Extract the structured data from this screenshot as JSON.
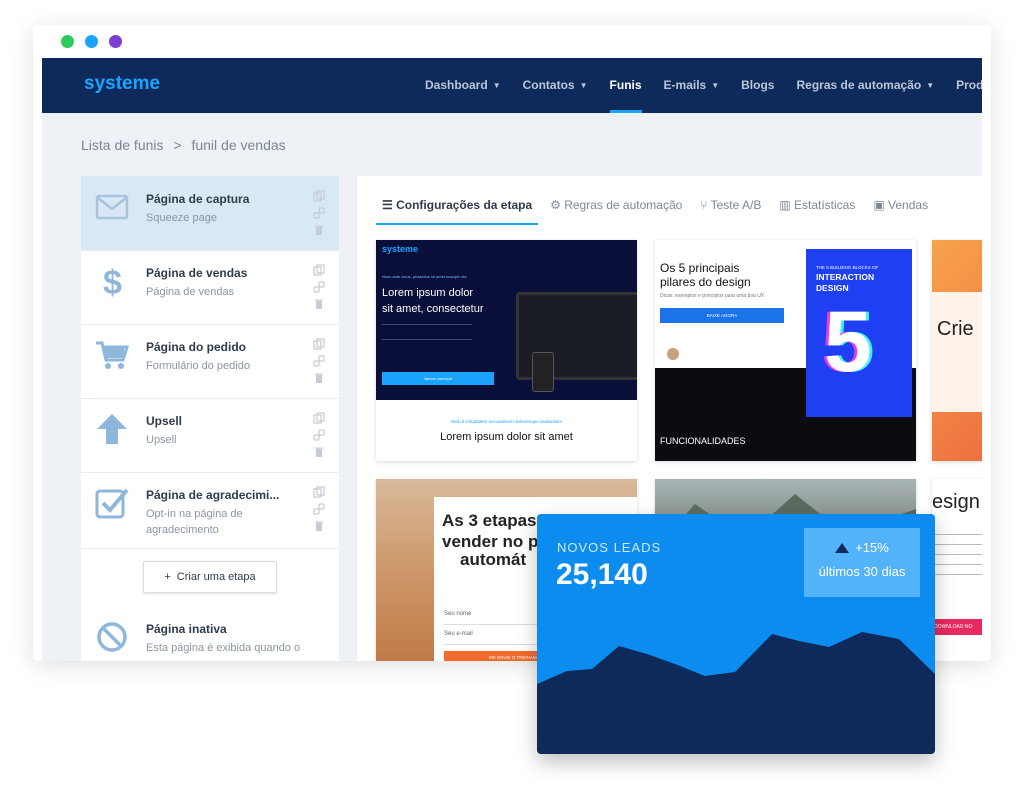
{
  "window": {
    "dot_colors": [
      "#2dcb5d",
      "#1aa3ff",
      "#7b3fd1"
    ]
  },
  "nav": {
    "logo": "systeme",
    "items": [
      {
        "label": "Dashboard",
        "caret": true,
        "active": false
      },
      {
        "label": "Contatos",
        "caret": true,
        "active": false
      },
      {
        "label": "Funis",
        "caret": false,
        "active": true
      },
      {
        "label": "E-mails",
        "caret": true,
        "active": false
      },
      {
        "label": "Blogs",
        "caret": false,
        "active": false
      },
      {
        "label": "Regras de automação",
        "caret": true,
        "active": false
      },
      {
        "label": "Produto",
        "caret": false,
        "active": false
      }
    ]
  },
  "breadcrumb": {
    "root": "Lista de funis",
    "separator": ">",
    "current": "funil de vendas"
  },
  "steps": [
    {
      "title": "Página de captura",
      "subtitle": "Squeeze page",
      "icon": "envelope-icon",
      "active": true
    },
    {
      "title": "Página de vendas",
      "subtitle": "Página de vendas",
      "icon": "dollar-icon",
      "active": false
    },
    {
      "title": "Página do pedido",
      "subtitle": "Formulário do pedido",
      "icon": "cart-icon",
      "active": false
    },
    {
      "title": "Upsell",
      "subtitle": "Upsell",
      "icon": "arrow-up-icon",
      "active": false
    },
    {
      "title": "Página de agradecimi...",
      "subtitle": "Opt-in na página de agradecimento",
      "icon": "checkbox-icon",
      "active": false
    },
    {
      "title": "Página inativa",
      "subtitle": "Esta página é exibida quando o",
      "icon": "disabled-icon",
      "active": false
    }
  ],
  "create_step": {
    "plus": "+",
    "label": "Criar uma etapa"
  },
  "tabs": [
    {
      "label": "Configurações da etapa",
      "icon": "menu-icon",
      "active": true
    },
    {
      "label": "Regras de automação",
      "icon": "gears-icon",
      "active": false
    },
    {
      "label": "Teste A/B",
      "icon": "split-icon",
      "active": false
    },
    {
      "label": "Estatísticas",
      "icon": "bar-chart-icon",
      "active": false
    },
    {
      "label": "Vendas",
      "icon": "money-icon",
      "active": false
    }
  ],
  "thumbnails": {
    "t1": {
      "brand": "systeme",
      "kicker": "Nunc ante lacus, phasellus sit amet suscipit nec",
      "headline1": "Lorem ipsum dolor",
      "headline2": "sit amet, consectetur",
      "button": "Vamos começar",
      "caption": "Sed ut voluptatem accusantium doloremque laudantium",
      "headline3": "Lorem ipsum dolor sit amet"
    },
    "t2": {
      "headline1": "Os 5 principais",
      "headline2": "pilares do design",
      "sub": "Dicas, exemplos e princípios para uma boa UX",
      "button": "BAIXE AGORA",
      "book_kicker": "THE 5 BUILDING BLOCKS OF",
      "book_title1": "INTERACTION",
      "book_title2": "DESIGN",
      "book_number": "5",
      "footer": "FUNCIONALIDADES"
    },
    "t3": {
      "headline": "Crie"
    },
    "t4": {
      "headline1": "As 3 etapas",
      "headline2": "vender no p",
      "headline3": "automát",
      "name_placeholder": "Seu nome",
      "email_placeholder": "Seu e-mail",
      "button": "ME ENVIE O TREINAMENTO"
    },
    "t6": {
      "headline": "esign",
      "button": "DOWNLOAD NO"
    }
  },
  "leads_card": {
    "label": "NOVOS LEADS",
    "value": "25,140",
    "delta": "+15%",
    "period": "últimos 30 dias"
  },
  "colors": {
    "nav_bg": "#0e2a5a",
    "accent": "#1aa3ff",
    "step_active_bg": "#d8e8f4",
    "card_bg": "#0d8cf0",
    "wave_fill": "#0e2a5a"
  }
}
